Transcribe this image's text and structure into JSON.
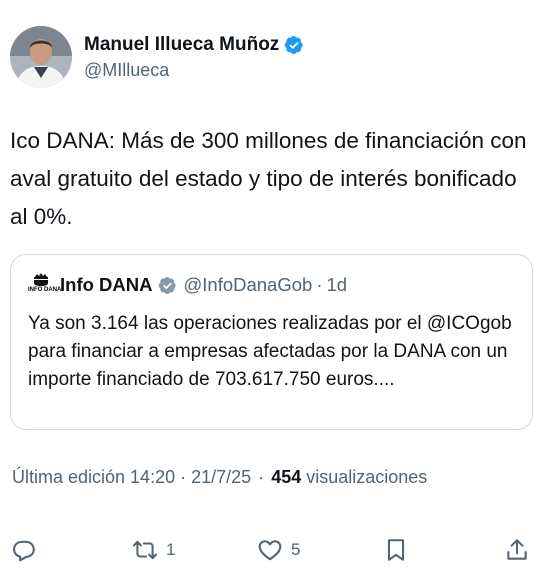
{
  "author": {
    "display_name": "Manuel Illueca Muñoz",
    "handle": "@MIllueca",
    "verified": true,
    "verified_color": "#1d9bf0"
  },
  "tweet": {
    "text": "Ico DANA: Más de 300 millones de financiación con aval gratuito del estado y tipo de interés bonificado al 0%."
  },
  "quoted": {
    "avatar_text": "INFO DANA",
    "display_name": "Info DANA",
    "verified_type": "gray-government",
    "handle": "@InfoDanaGob",
    "separator": "·",
    "time": "1d",
    "text": "Ya son 3.164 las operaciones realizadas por el @ICOgob para financiar a empresas afectadas por la DANA con un importe financiado de 703.617.750 euros...."
  },
  "meta": {
    "edited_label": "Última edición 14:20 · 21/7/25",
    "separator": "·",
    "views_count": "454",
    "views_label": "visualizaciones"
  },
  "actions": {
    "reply_icon": "reply-icon",
    "reply_count": "",
    "repost_icon": "repost-icon",
    "repost_count": "1",
    "like_icon": "like-icon",
    "like_count": "5",
    "bookmark_icon": "bookmark-icon",
    "share_icon": "share-icon"
  },
  "colors": {
    "text_primary": "#0f1419",
    "text_secondary": "#536471",
    "border": "#cfd9de",
    "verified_blue": "#1d9bf0"
  }
}
